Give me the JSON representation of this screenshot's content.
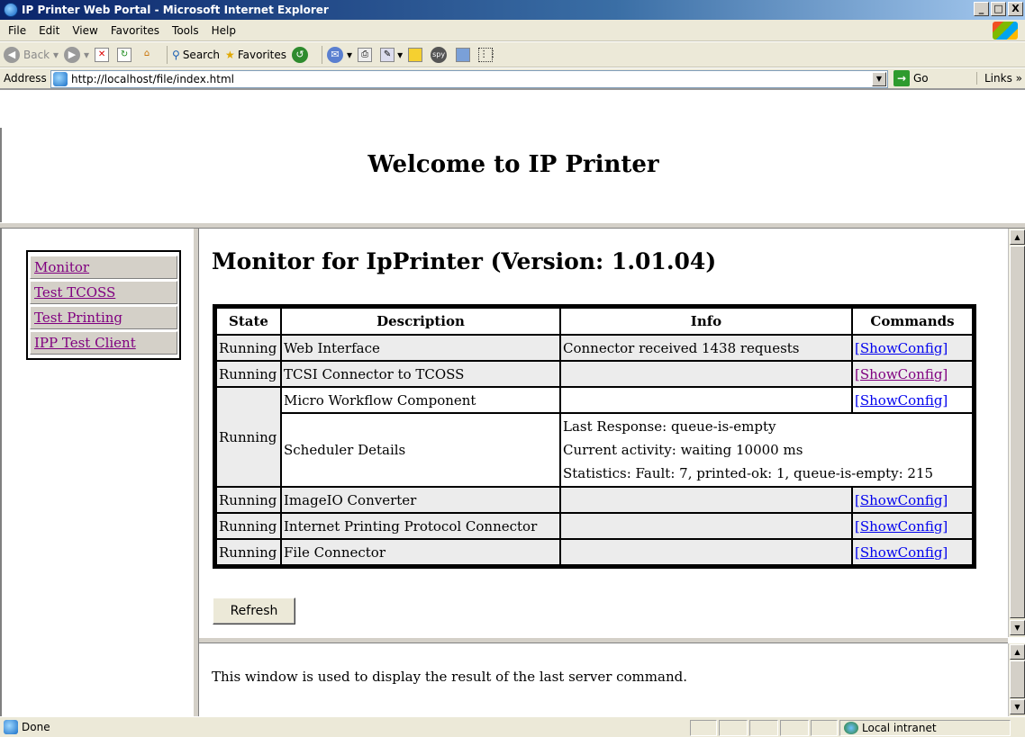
{
  "window": {
    "title": "IP Printer Web Portal - Microsoft Internet Explorer",
    "minimize": "_",
    "maximize": "□",
    "close": "X"
  },
  "menu": [
    "File",
    "Edit",
    "View",
    "Favorites",
    "Tools",
    "Help"
  ],
  "toolbar": {
    "back": "Back",
    "search": "Search",
    "favorites": "Favorites"
  },
  "address": {
    "label": "Address",
    "url": "http://localhost/file/index.html",
    "go": "Go",
    "links": "Links"
  },
  "header": {
    "title": "Welcome to IP Printer"
  },
  "nav": [
    {
      "label": "Monitor"
    },
    {
      "label": "Test TCOSS"
    },
    {
      "label": "Test Printing"
    },
    {
      "label": "IPP Test Client"
    }
  ],
  "main": {
    "title": "Monitor for IpPrinter (Version: 1.01.04)",
    "columns": [
      "State",
      "Description",
      "Info",
      "Commands"
    ],
    "rows": [
      {
        "state": "Running",
        "desc": "Web Interface",
        "info": "Connector received 1438 requests",
        "cmd": "[ShowConfig]"
      },
      {
        "state": "Running",
        "desc": "TCSI Connector to TCOSS",
        "info": "",
        "cmd": "[ShowConfig]"
      },
      {
        "state": "Running",
        "desc": "Micro Workflow Component",
        "info": "",
        "cmd": "[ShowConfig]"
      },
      {
        "desc": "Scheduler Details",
        "info_lines": [
          "Last Response: queue-is-empty",
          "Current activity: waiting 10000 ms",
          "Statistics: Fault: 7, printed-ok: 1, queue-is-empty: 215"
        ]
      },
      {
        "state": "Running",
        "desc": "ImageIO Converter",
        "info": "",
        "cmd": "[ShowConfig]"
      },
      {
        "state": "Running",
        "desc": "Internet Printing Protocol Connector",
        "info": "",
        "cmd": "[ShowConfig]"
      },
      {
        "state": "Running",
        "desc": "File Connector",
        "info": "",
        "cmd": "[ShowConfig]"
      }
    ],
    "refresh": "Refresh"
  },
  "result": {
    "text": "This window is used to display the result of the last server command."
  },
  "status": {
    "text": "Done",
    "zone": "Local intranet"
  }
}
